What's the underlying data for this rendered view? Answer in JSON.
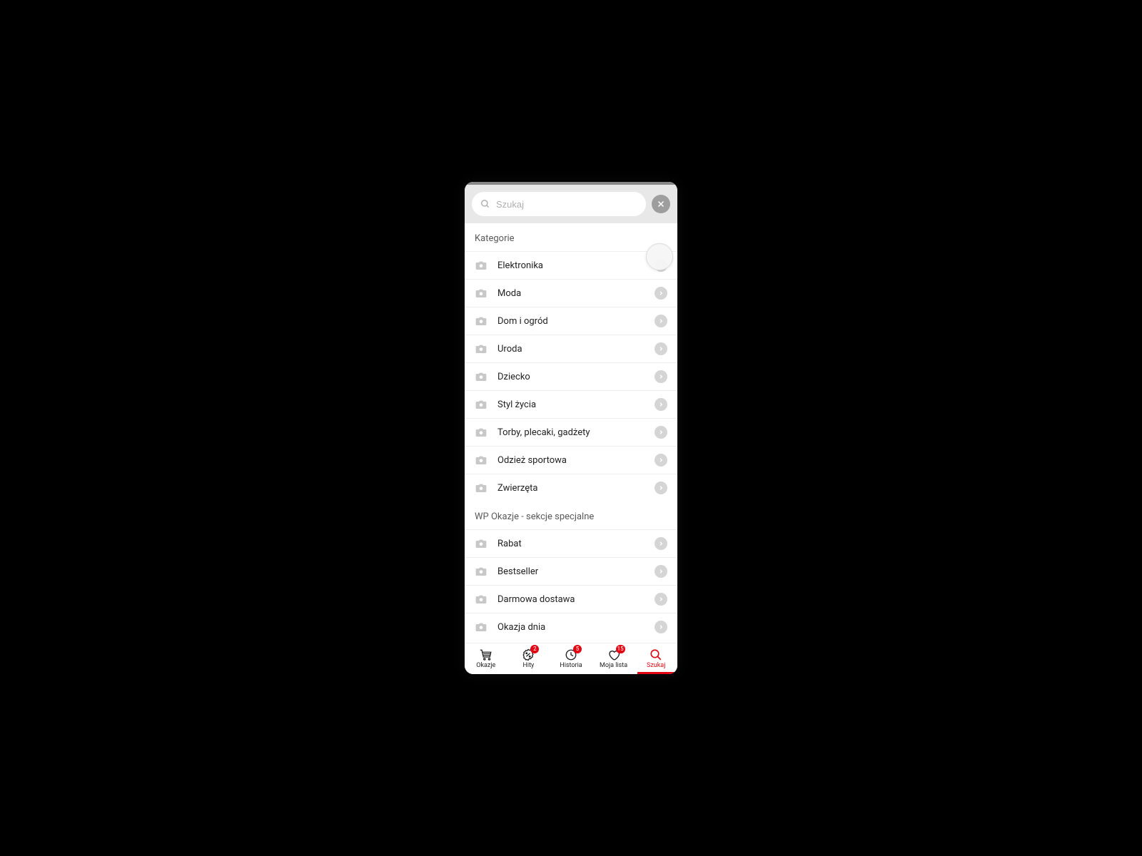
{
  "search": {
    "placeholder": "Szukaj"
  },
  "sections": {
    "categories": {
      "title": "Kategorie",
      "items": [
        "Elektronika",
        "Moda",
        "Dom i ogród",
        "Uroda",
        "Dziecko",
        "Styl życia",
        "Torby, plecaki, gadżety",
        "Odzież sportowa",
        "Zwierzęta"
      ]
    },
    "special": {
      "title": "WP Okazje - sekcje specjalne",
      "items": [
        "Rabat",
        "Bestseller",
        "Darmowa dostawa",
        "Okazja dnia"
      ]
    }
  },
  "nav": {
    "okazje": {
      "label": "Okazje"
    },
    "hity": {
      "label": "Hity",
      "badge": "2"
    },
    "historia": {
      "label": "Historia",
      "badge": "5"
    },
    "mojalista": {
      "label": "Moja lista",
      "badge": "15"
    },
    "szukaj": {
      "label": "Szukaj"
    }
  }
}
